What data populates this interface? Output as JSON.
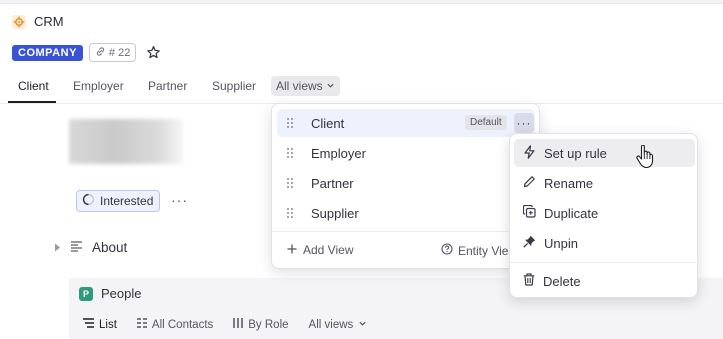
{
  "app": {
    "title": "CRM",
    "icon": "crm-gear-icon"
  },
  "record": {
    "type_badge": "COMPANY",
    "id_label": "# 22"
  },
  "tabs": [
    {
      "label": "Client"
    },
    {
      "label": "Employer"
    },
    {
      "label": "Partner"
    },
    {
      "label": "Supplier"
    }
  ],
  "all_views_label": "All views",
  "status": {
    "label": "Interested"
  },
  "about_label": "About",
  "people": {
    "title": "People",
    "badge": "P",
    "tabs": [
      {
        "label": "List"
      },
      {
        "label": "All Contacts"
      },
      {
        "label": "By Role"
      },
      {
        "label": "All views"
      }
    ]
  },
  "views_menu": {
    "items": [
      {
        "label": "Client",
        "tag": "Default"
      },
      {
        "label": "Employer"
      },
      {
        "label": "Partner"
      },
      {
        "label": "Supplier"
      }
    ],
    "add_view": "Add View",
    "entity_view": "Entity Vie"
  },
  "context_menu": {
    "items": [
      {
        "label": "Set up rule",
        "icon": "lightning-icon"
      },
      {
        "label": "Rename",
        "icon": "pencil-icon"
      },
      {
        "label": "Duplicate",
        "icon": "duplicate-icon"
      },
      {
        "label": "Unpin",
        "icon": "pin-icon"
      },
      {
        "label": "Delete",
        "icon": "trash-icon"
      }
    ]
  },
  "colors": {
    "accent": "#3a53d4",
    "people_badge": "#2e9c7a",
    "app_icon": "#e8912c"
  }
}
